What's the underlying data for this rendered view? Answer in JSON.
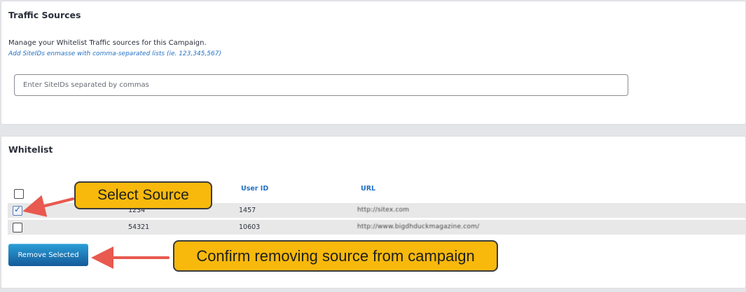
{
  "traffic_sources": {
    "title": "Traffic Sources",
    "intro": "Manage your Whitelist Traffic sources for this Campaign.",
    "hint": "Add SiteIDs enmasse with comma-separated lists (ie. 123,345,567)",
    "input_placeholder": "Enter SiteIDs separated by commas",
    "input_value": ""
  },
  "whitelist": {
    "title": "Whitelist",
    "columns": [
      "",
      "User ID",
      "URL"
    ],
    "rows": [
      {
        "checked": true,
        "site_id": "1234",
        "user_id": "1457",
        "url": "http://sitex.com"
      },
      {
        "checked": false,
        "site_id": "54321",
        "user_id": "10603",
        "url": "http://www.bigdhduckmagazine.com/"
      }
    ],
    "remove_label": "Remove Selected"
  },
  "callouts": {
    "select": "Select Source",
    "confirm": "Confirm removing source from campaign"
  },
  "colors": {
    "accent_blue": "#2371c4",
    "callout": "#f8b90c",
    "arrow": "#e8594f"
  }
}
